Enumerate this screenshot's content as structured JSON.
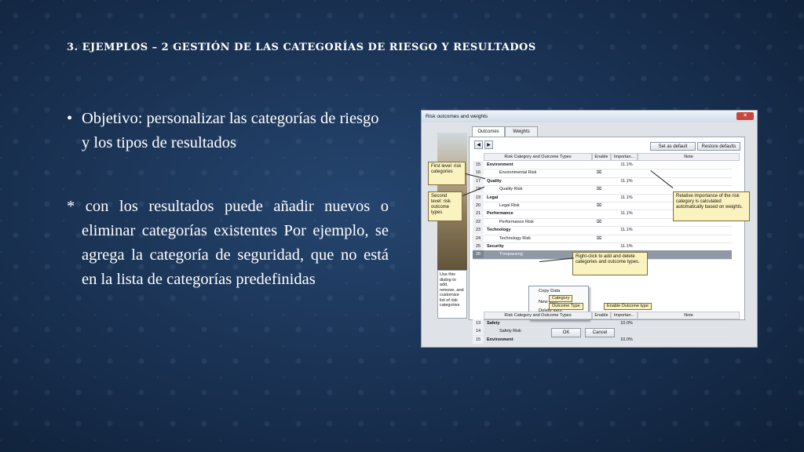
{
  "slide": {
    "title": "3. EJEMPLOS – 2 GESTIÓN DE LAS CATEGORÍAS DE RIESGO Y RESULTADOS",
    "bullet1_marker": "•",
    "bullet1": "Objetivo: personalizar las categorías de riesgo y los tipos de resultados",
    "bullet2": "* con los  resultados puede añadir nuevos o eliminar categorías existentes Por ejemplo, se agrega la categoría de seguridad, que no está en la lista de categorías predefinidas"
  },
  "window": {
    "title": "Risk outcomes and weights",
    "close": "✕",
    "tabs": [
      "Outcomes",
      "Weights"
    ],
    "set_default": "Set as default",
    "restore_defaults": "Restore defaults",
    "columns": [
      "Risk Category and Outcome Types",
      "Enable",
      "Importan...",
      "Note"
    ],
    "rows": [
      {
        "n": "15",
        "label": "Environment",
        "bold": true,
        "weight": "11.1%",
        "enable": ""
      },
      {
        "n": "16",
        "label": "Environmental Risk",
        "bold": false,
        "weight": "",
        "enable": "⌧"
      },
      {
        "n": "17",
        "label": "Quality",
        "bold": true,
        "weight": "11.1%",
        "enable": ""
      },
      {
        "n": "18",
        "label": "Quality Risk",
        "bold": false,
        "weight": "",
        "enable": "⌧"
      },
      {
        "n": "19",
        "label": "Legal",
        "bold": true,
        "weight": "11.1%",
        "enable": ""
      },
      {
        "n": "20",
        "label": "Legal Risk",
        "bold": false,
        "weight": "",
        "enable": "⌧"
      },
      {
        "n": "21",
        "label": "Performance",
        "bold": true,
        "weight": "11.1%",
        "enable": ""
      },
      {
        "n": "22",
        "label": "Performance Risk",
        "bold": false,
        "weight": "",
        "enable": "⌧"
      },
      {
        "n": "23",
        "label": "Technology",
        "bold": true,
        "weight": "11.1%",
        "enable": ""
      },
      {
        "n": "24",
        "label": "Technology Risk",
        "bold": false,
        "weight": "",
        "enable": "⌧"
      },
      {
        "n": "25",
        "label": "Security",
        "bold": true,
        "weight": "11.1%",
        "enable": ""
      },
      {
        "n": "26",
        "label": "Trespassing",
        "bold": false,
        "weight": "",
        "enable": ""
      }
    ],
    "context_menu": [
      "Copy Data",
      "New Item",
      "Delete Item"
    ],
    "bottom_columns": [
      "Risk Category and Outcome Types",
      "Enable",
      "Importan...",
      "Note"
    ],
    "bottom_rows": [
      {
        "n": "13",
        "label": "Safety",
        "bold": true,
        "weight": "10.0%",
        "enable": ""
      },
      {
        "n": "14",
        "label": "Safety Risk",
        "bold": false,
        "weight": "",
        "enable": "⌧"
      },
      {
        "n": "15",
        "label": "Environment",
        "bold": true,
        "weight": "10.0%",
        "enable": ""
      }
    ],
    "help_text": "Use this dialog to add, remove, and customize list of risk categories",
    "ok": "OK",
    "cancel": "Cancel"
  },
  "callouts": {
    "first_level": "First level: risk categories",
    "second_level": "Second level: risk outcome types",
    "relative": "Relative importance of the risk category is calculated automatically based on weights.",
    "right_click": "Right-click to add and delete categories and outcome types.",
    "category_tag": "Category",
    "outcome_tag": "Outcome Type",
    "enable_tag": "Enable Outcome type"
  }
}
